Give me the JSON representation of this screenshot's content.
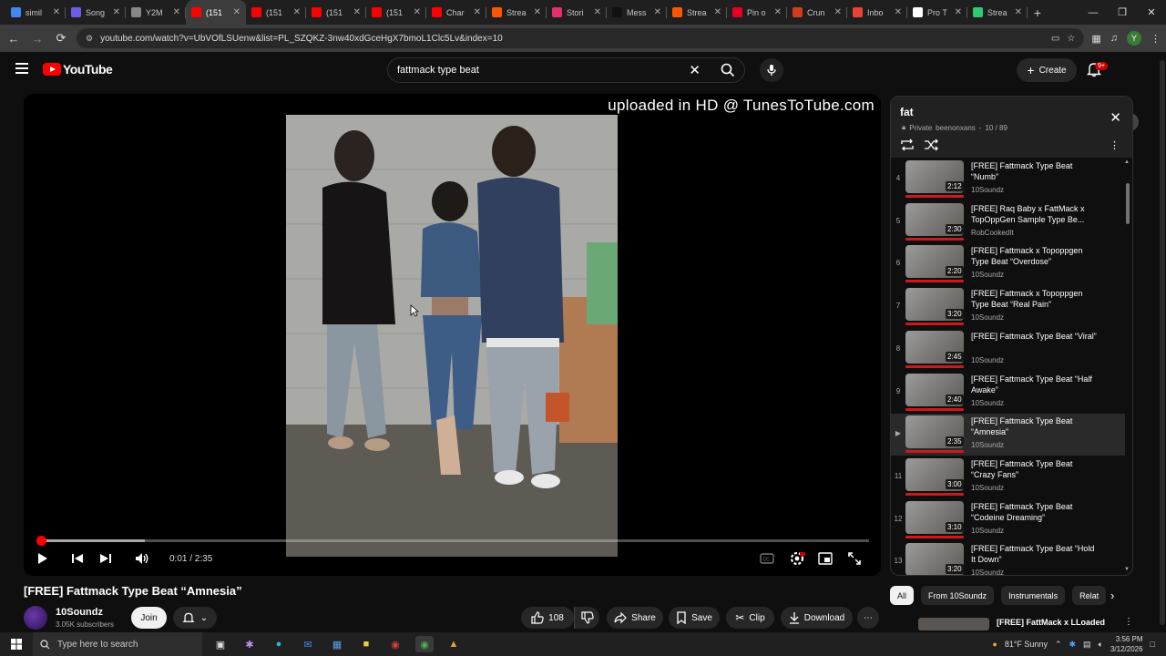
{
  "browser": {
    "tabs": [
      {
        "label": "simil",
        "color": "#4285f4"
      },
      {
        "label": "Song",
        "color": "#6c5ce7"
      },
      {
        "label": "Y2M",
        "color": "#888888"
      },
      {
        "label": "(151",
        "color": "#ff0000",
        "active": true
      },
      {
        "label": "(151",
        "color": "#ff0000"
      },
      {
        "label": "(151",
        "color": "#ff0000"
      },
      {
        "label": "(151",
        "color": "#ff0000"
      },
      {
        "label": "Char",
        "color": "#ff0000"
      },
      {
        "label": "Strea",
        "color": "#ff5500"
      },
      {
        "label": "Stori",
        "color": "#e1306c"
      },
      {
        "label": "Mess",
        "color": "#111111"
      },
      {
        "label": "Strea",
        "color": "#ff5500"
      },
      {
        "label": "Pin o",
        "color": "#e60023"
      },
      {
        "label": "Crun",
        "color": "#d33c1c"
      },
      {
        "label": "Inbo",
        "color": "#ea4335"
      },
      {
        "label": "Pro T",
        "color": "#ffffff"
      },
      {
        "label": "Strea",
        "color": "#2ecc71"
      }
    ],
    "url": "youtube.com/watch?v=UbVOfLSUenw&list=PL_SZQKZ-3nw40xdGceHgX7bmoL1Clc5Lv&index=10",
    "profile_letter": "Y"
  },
  "header": {
    "logo_text": "YouTube",
    "search_query": "fattmack type beat",
    "create_label": "Create",
    "notification_badge": "9+"
  },
  "player": {
    "overlay_text": "uploaded in HD @ TunesToTube.com",
    "current_time": "0:01",
    "duration": "2:35",
    "played_fraction": 0.006,
    "buffered_fraction": 0.13,
    "time_display": "0:01 / 2:35"
  },
  "video": {
    "title": "[FREE] Fattmack Type Beat “Amnesia”",
    "channel": "10Soundz",
    "subscribers": "3.05K subscribers",
    "join_label": "Join",
    "like_count": "108",
    "share_label": "Share",
    "save_label": "Save",
    "clip_label": "Clip",
    "download_label": "Download"
  },
  "playlist": {
    "name": "fat",
    "privacy": "Private",
    "owner": "beenonxans",
    "position": "10 / 89",
    "items": [
      {
        "index": "4",
        "title": "[FREE] Fattmack Type Beat “Numb”",
        "channel": "10Soundz",
        "duration": "2:12"
      },
      {
        "index": "5",
        "title": "[FREE] Raq Baby x FattMack x TopOppGen Sample Type Be...",
        "channel": "RobCookedIt",
        "duration": "2:30"
      },
      {
        "index": "6",
        "title": "[FREE] Fattmack x Topoppgen Type Beat “Overdose”",
        "channel": "10Soundz",
        "duration": "2:20"
      },
      {
        "index": "7",
        "title": "[FREE] Fattmack x Topoppgen Type Beat “Real Pain”",
        "channel": "10Soundz",
        "duration": "3:20"
      },
      {
        "index": "8",
        "title": "[FREE] Fattmack Type Beat “Viral”",
        "channel": "10Soundz",
        "duration": "2:45"
      },
      {
        "index": "9",
        "title": "[FREE] Fattmack Type Beat “Half Awake”",
        "channel": "10Soundz",
        "duration": "2:40"
      },
      {
        "index": "▶",
        "title": "[FREE] Fattmack Type Beat “Amnesia”",
        "channel": "10Soundz",
        "duration": "2:35",
        "current": true
      },
      {
        "index": "11",
        "title": "[FREE] Fattmack Type Beat “Crazy Fans”",
        "channel": "10Soundz",
        "duration": "3:00"
      },
      {
        "index": "12",
        "title": "[FREE] Fattmack Type Beat “Codeine Dreaming”",
        "channel": "10Soundz",
        "duration": "3:10"
      },
      {
        "index": "13",
        "title": "[FREE] Fattmack Type Beat “Hold It Down”",
        "channel": "10Soundz",
        "duration": "3:20"
      }
    ]
  },
  "chips": [
    "All",
    "From 10Soundz",
    "Instrumentals",
    "Relat"
  ],
  "next_video_title": "[FREE] FattMack x LLoaded",
  "taskbar": {
    "search_placeholder": "Type here to search",
    "weather": "81°F  Sunny",
    "time": "3:56 PM",
    "date": "3/12/2026"
  },
  "colors": {
    "accent": "#ff0000",
    "background": "#0f0f0f"
  }
}
